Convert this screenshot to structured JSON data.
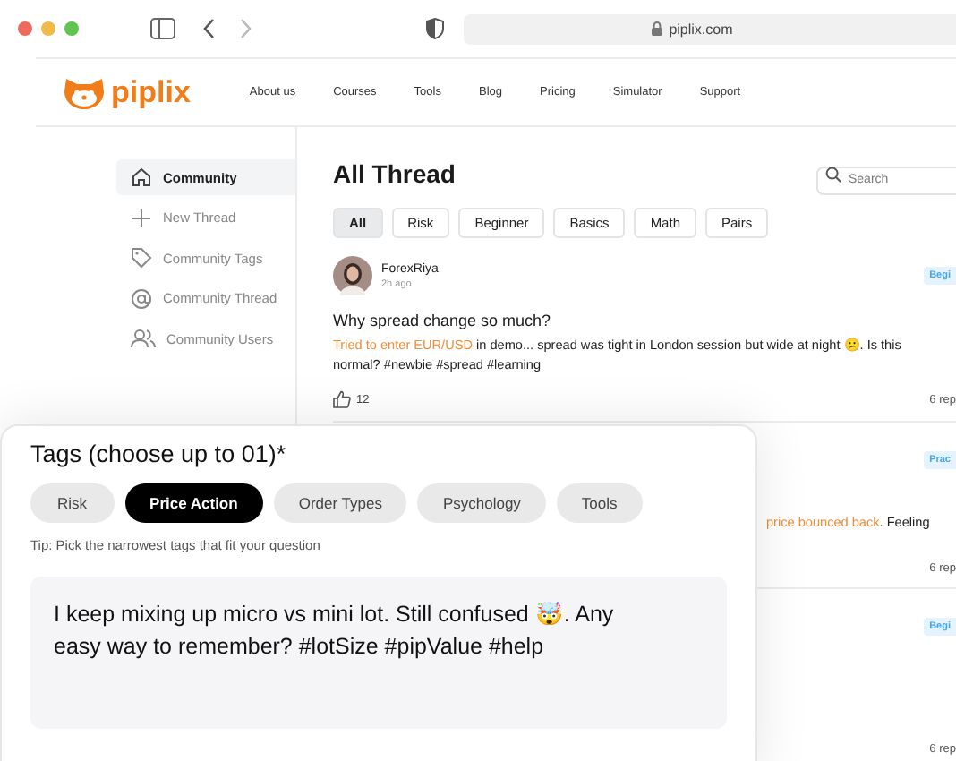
{
  "browser": {
    "url": "piplix.com"
  },
  "site": {
    "logo": "piplix",
    "nav": [
      "About us",
      "Courses",
      "Tools",
      "Blog",
      "Pricing",
      "Simulator",
      "Support"
    ]
  },
  "sidebar": {
    "items": [
      {
        "label": "Community",
        "kind": "home",
        "selected": true
      },
      {
        "label": "New Thread",
        "kind": "add",
        "selected": false
      },
      {
        "label": "Community Tags",
        "kind": "tags",
        "selected": false
      },
      {
        "label": "Community Thread",
        "kind": "mentions",
        "selected": false
      },
      {
        "label": "Community Users",
        "kind": "users",
        "selected": false
      }
    ]
  },
  "main": {
    "title": "All Thread",
    "search": {
      "placeholder": "Search"
    },
    "filters": [
      {
        "label": "All",
        "selected": true
      },
      {
        "label": "Risk",
        "selected": false
      },
      {
        "label": "Beginner",
        "selected": false
      },
      {
        "label": "Basics",
        "selected": false
      },
      {
        "label": "Math",
        "selected": false
      },
      {
        "label": "Pairs",
        "selected": false
      }
    ],
    "posts": [
      {
        "author": "ForexRiya",
        "time": "2h ago",
        "badge": "Begi",
        "title": "Why spread change so much?",
        "highlight": "Tried to enter EUR/USD",
        "text": " in demo... spread was tight in London session but wide at night 😕. Is this normal? #newbie #spread #learning",
        "likes": "12",
        "replies": "6 rep"
      },
      {
        "badge": "Prac",
        "highlight": "price bounced back",
        "text": ". Feeling",
        "replies": "6 rep"
      },
      {
        "badge": "Begi",
        "replies": "6 rep"
      }
    ]
  },
  "tags_card": {
    "title": "Tags (choose up to 01)*",
    "tags": [
      {
        "label": "Risk",
        "selected": false
      },
      {
        "label": "Price Action",
        "selected": true
      },
      {
        "label": "Order Types",
        "selected": false
      },
      {
        "label": "Psychology",
        "selected": false
      },
      {
        "label": "Tools",
        "selected": false
      }
    ],
    "tip": "Tip: Pick the narrowest tags that fit your question",
    "question": "I keep mixing up micro vs mini lot. Still confused 🤯. Any easy way to remember? #lotSize #pipValue #help"
  }
}
